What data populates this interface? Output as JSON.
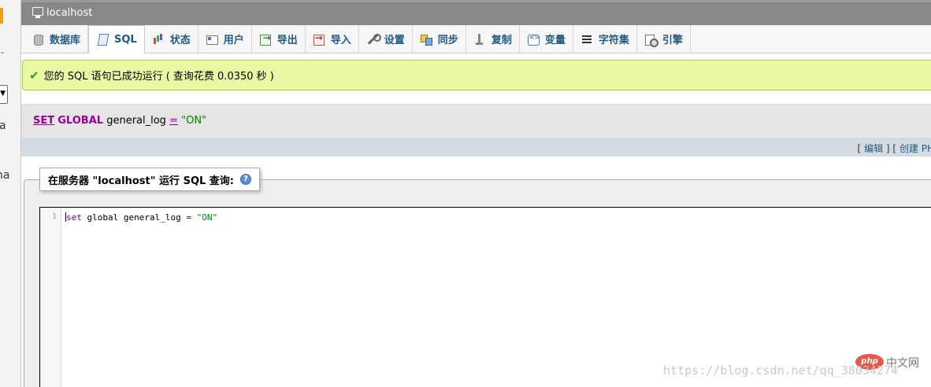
{
  "leftnav": {
    "dash": "-",
    "text_a": "a",
    "text_ma": "na"
  },
  "server": {
    "name": "localhost"
  },
  "tabs": [
    {
      "label": "数据库",
      "icon": "database-icon"
    },
    {
      "label": "SQL",
      "icon": "sql-icon",
      "active": true
    },
    {
      "label": "状态",
      "icon": "status-icon"
    },
    {
      "label": "用户",
      "icon": "user-icon"
    },
    {
      "label": "导出",
      "icon": "export-icon"
    },
    {
      "label": "导入",
      "icon": "import-icon"
    },
    {
      "label": "设置",
      "icon": "settings-icon"
    },
    {
      "label": "同步",
      "icon": "sync-icon"
    },
    {
      "label": "复制",
      "icon": "replication-icon"
    },
    {
      "label": "变量",
      "icon": "variables-icon"
    },
    {
      "label": "字符集",
      "icon": "charset-icon"
    },
    {
      "label": "引擎",
      "icon": "engine-icon"
    }
  ],
  "success": {
    "message": "您的 SQL 语句已成功运行 ( 查询花费 0.0350 秒 )"
  },
  "executed_query": {
    "kw_set": "SET",
    "kw_global": "GLOBAL",
    "variable": "general_log",
    "operator": "=",
    "value": "\"ON\"",
    "link_open": "[",
    "edit_link": "编辑",
    "separator": "] [",
    "create_link": "创建 PH"
  },
  "sql_panel": {
    "legend": "在服务器 \"localhost\" 运行 SQL 查询:",
    "help_glyph": "?",
    "line_number": "1",
    "code_kw": "set",
    "code_mid": " global general_log ",
    "code_op": "=",
    "code_str": "\"ON\""
  },
  "watermark": {
    "url": "https://blog.csdn.net/qq_38034274",
    "badge": "php",
    "badge_text": "中文网"
  }
}
